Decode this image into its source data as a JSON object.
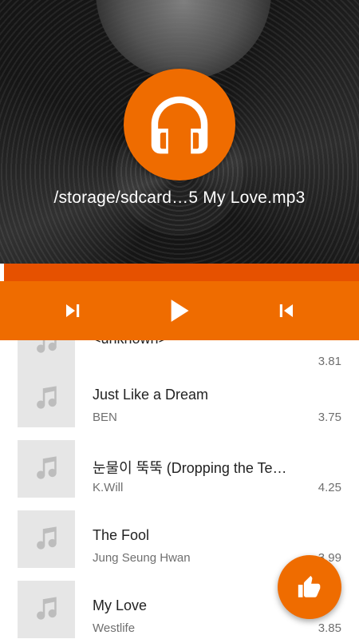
{
  "now_playing": {
    "path": "/storage/sdcard…5 My Love.mp3",
    "progress": 0.012
  },
  "controls": {
    "next_icon": "skip-next-icon",
    "play_icon": "play-icon",
    "prev_icon": "skip-previous-icon"
  },
  "playlist": [
    {
      "title": "<unknown>",
      "artist": "",
      "size": "3.81"
    },
    {
      "title": "Just Like a Dream",
      "artist": "BEN",
      "size": "3.75"
    },
    {
      "title": "눈물이 뚝뚝 (Dropping the Te…",
      "artist": "K.Will",
      "size": "4.25"
    },
    {
      "title": "The Fool",
      "artist": "Jung Seung Hwan",
      "size": "3.99"
    },
    {
      "title": "My Love",
      "artist": "Westlife",
      "size": "3.85"
    }
  ],
  "colors": {
    "accent": "#ef6c00",
    "accent_dark": "#e65100",
    "thumb_bg": "#e6e6e6"
  },
  "fab": {
    "icon": "thumbs-up-icon"
  }
}
